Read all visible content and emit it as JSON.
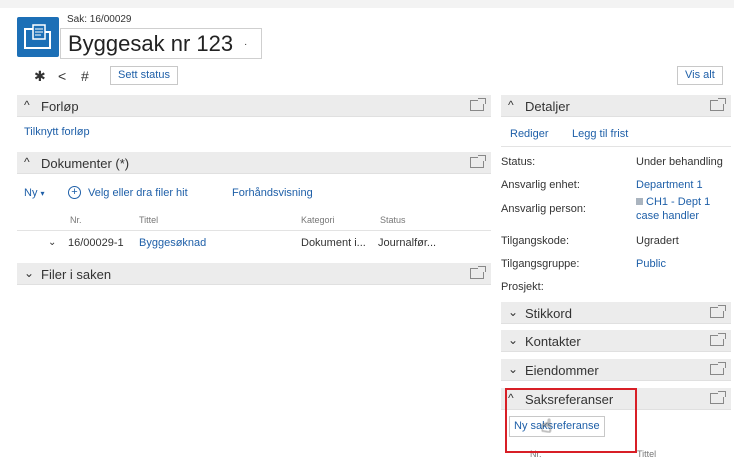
{
  "header": {
    "sak_number": "Sak: 16/00029",
    "title": "Byggesak nr 123",
    "title_caret": "·",
    "set_status_label": "Sett status",
    "show_all_label": "Vis alt"
  },
  "toolbar": {
    "icons": [
      "pin-icon",
      "share-icon",
      "hash-icon"
    ],
    "pin_glyph": "✱",
    "share_glyph": "<",
    "hash_glyph": "#"
  },
  "left": {
    "forlop": {
      "title": "Forløp",
      "arrow": "^",
      "link": "Tilknytt forløp"
    },
    "dokumenter": {
      "title": "Dokumenter (*)",
      "arrow": "^",
      "new_label": "Ny",
      "new_caret": "▾",
      "add_glyph": "+",
      "add_files_label": "Velg eller dra filer hit",
      "preview_label": "Forhåndsvisning",
      "columns": [
        "Nr.",
        "Tittel",
        "Kategori",
        "Status"
      ],
      "rows": [
        {
          "expand": "⌄",
          "nr": "16/00029-1",
          "title": "Byggesøknad",
          "category": "Dokument i...",
          "status": "Journalfør..."
        }
      ]
    },
    "filer": {
      "title": "Filer i saken",
      "arrow": "⌄"
    }
  },
  "right": {
    "detaljer": {
      "title": "Detaljer",
      "arrow": "^",
      "edit_label": "Rediger",
      "add_deadline_label": "Legg til frist",
      "fields": [
        {
          "label": "Status:",
          "value": "Under behandling"
        },
        {
          "label": "Ansvarlig enhet:",
          "value": "Department 1"
        },
        {
          "label": "Ansvarlig person:",
          "value": "CH1 - Dept 1",
          "value2": "case handler"
        },
        {
          "label": "Tilgangskode:",
          "value": "Ugradert"
        },
        {
          "label": "Tilgangsgruppe:",
          "value": "Public"
        },
        {
          "label": "Prosjekt:",
          "value": ""
        }
      ]
    },
    "collapsed_sections": [
      {
        "title": "Stikkord",
        "arrow": "⌄"
      },
      {
        "title": "Kontakter",
        "arrow": "⌄"
      },
      {
        "title": "Eiendommer",
        "arrow": "⌄"
      }
    ],
    "saksreferanser": {
      "title": "Saksreferanser",
      "arrow": "^",
      "new_label": "Ny saksreferanse",
      "columns": [
        "Nr.",
        "Tittel"
      ]
    }
  },
  "colors": {
    "accent": "#1e5fa8",
    "highlight": "#d81f26",
    "panel_header": "#ececec"
  }
}
